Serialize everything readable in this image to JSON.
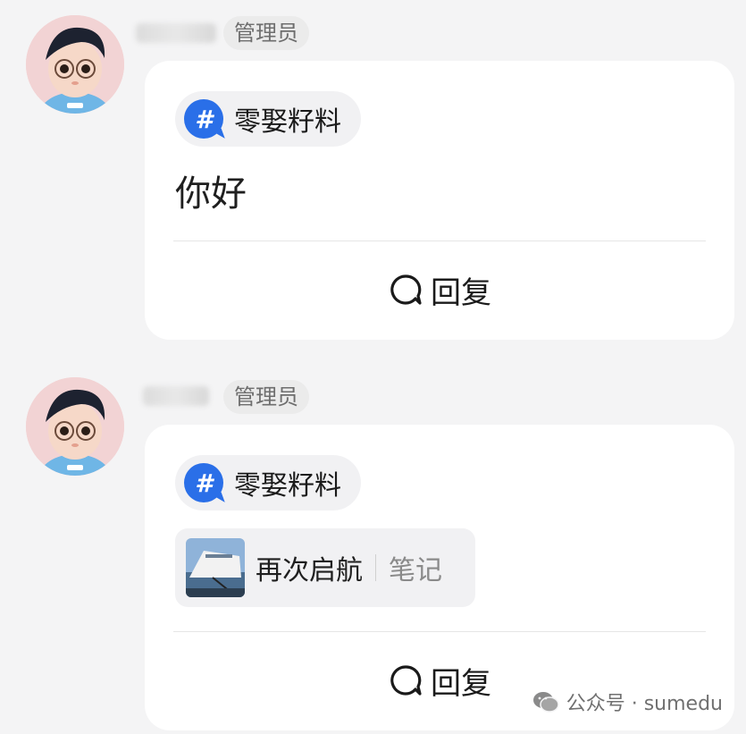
{
  "posts": [
    {
      "author_role": "管理员",
      "topic": "零娶籽料",
      "text": "你好",
      "reply_label": "回复"
    },
    {
      "author_role": "管理员",
      "topic": "零娶籽料",
      "note": {
        "title": "再次启航",
        "type": "笔记"
      },
      "reply_label": "回复"
    }
  ],
  "watermark": "公众号 · sumedu",
  "icons": [
    "avatar",
    "hashtag-icon",
    "reply-bubble-icon",
    "note-thumbnail",
    "wechat-icon"
  ],
  "colors": {
    "topic_icon": "#2a6fe8",
    "background": "#f4f4f5",
    "card": "#ffffff"
  }
}
